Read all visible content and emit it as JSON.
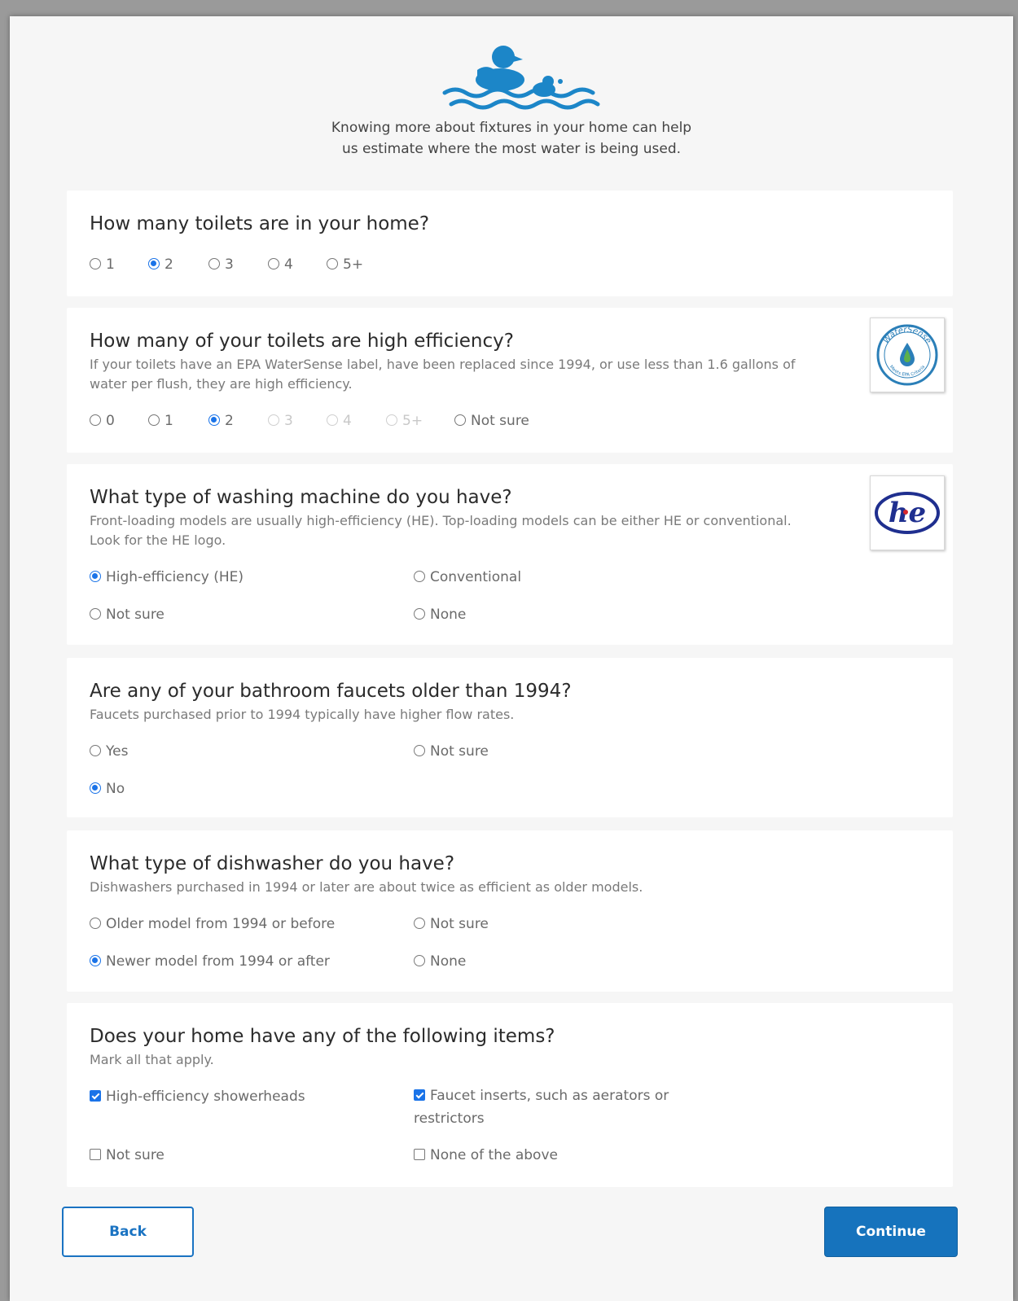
{
  "intro": {
    "line1": "Knowing more about fixtures in your home can help",
    "line2": "us estimate where the most water is being used."
  },
  "q1": {
    "title": "How many toilets are in your home?",
    "options": [
      "1",
      "2",
      "3",
      "4",
      "5+"
    ],
    "selected": "2"
  },
  "q2": {
    "title": "How many of your toilets are high efficiency?",
    "help": "If your toilets have an EPA WaterSense label, have been replaced since 1994, or use less than 1.6 gallons of water per flush, they are high efficiency.",
    "options": [
      "0",
      "1",
      "2",
      "3",
      "4",
      "5+",
      "Not sure"
    ],
    "disabled": [
      "3",
      "4",
      "5+"
    ],
    "selected": "2",
    "badge_text": [
      "WaterSense",
      "Meets EPA Criteria"
    ]
  },
  "q3": {
    "title": "What type of washing machine do you have?",
    "help": "Front-loading models are usually high-efficiency (HE). Top-loading models can be either HE or conventional. Look for the HE logo.",
    "options": [
      "High-efficiency (HE)",
      "Conventional",
      "Not sure",
      "None"
    ],
    "selected": "High-efficiency (HE)",
    "badge_text": [
      "he"
    ]
  },
  "q4": {
    "title": "Are any of your bathroom faucets older than 1994?",
    "help": "Faucets purchased prior to 1994 typically have higher flow rates.",
    "options": [
      "Yes",
      "Not sure",
      "No"
    ],
    "selected": "No"
  },
  "q5": {
    "title": "What type of dishwasher do you have?",
    "help": "Dishwashers purchased in 1994 or later are about twice as efficient as older models.",
    "options": [
      "Older model from 1994 or before",
      "Not sure",
      "Newer model from 1994 or after",
      "None"
    ],
    "selected": "Newer model from 1994 or after"
  },
  "q6": {
    "title": "Does your home have any of the following items?",
    "help": "Mark all that apply.",
    "options": [
      "High-efficiency showerheads",
      "Faucet inserts, such as aerators or restrictors",
      "Not sure",
      "None of the above"
    ],
    "checked": [
      "High-efficiency showerheads",
      "Faucet inserts, such as aerators or restrictors"
    ]
  },
  "buttons": {
    "back": "Back",
    "continue": "Continue"
  },
  "colors": {
    "accent": "#1a73e8",
    "primary_button": "#1673bd",
    "logo_blue": "#1c86c8"
  }
}
